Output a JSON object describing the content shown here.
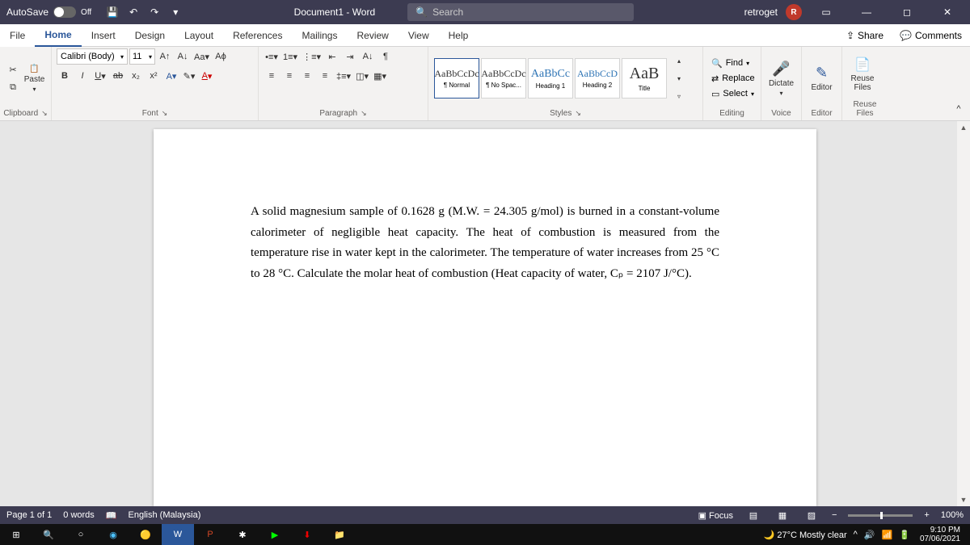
{
  "titlebar": {
    "autosave_label": "AutoSave",
    "autosave_state": "Off",
    "doc_title": "Document1 - Word",
    "search_placeholder": "Search",
    "username": "retroget",
    "user_initial": "R"
  },
  "tabs": {
    "file": "File",
    "items": [
      "Home",
      "Insert",
      "Design",
      "Layout",
      "References",
      "Mailings",
      "Review",
      "View",
      "Help"
    ],
    "active": "Home",
    "share": "Share",
    "comments": "Comments"
  },
  "ribbon": {
    "clipboard": {
      "label": "Clipboard",
      "paste": "Paste"
    },
    "font": {
      "label": "Font",
      "name": "Calibri (Body)",
      "size": "11"
    },
    "paragraph": {
      "label": "Paragraph"
    },
    "styles": {
      "label": "Styles",
      "items": [
        {
          "sample": "AaBbCcDc",
          "name": "¶ Normal"
        },
        {
          "sample": "AaBbCcDc",
          "name": "¶ No Spac..."
        },
        {
          "sample": "AaBbCc",
          "name": "Heading 1"
        },
        {
          "sample": "AaBbCcD",
          "name": "Heading 2"
        },
        {
          "sample": "AaB",
          "name": "Title"
        }
      ]
    },
    "editing": {
      "label": "Editing",
      "find": "Find",
      "replace": "Replace",
      "select": "Select"
    },
    "voice": {
      "label": "Voice",
      "dictate": "Dictate"
    },
    "editor": {
      "label": "Editor",
      "editor": "Editor"
    },
    "reuse": {
      "label": "Reuse Files",
      "reuse": "Reuse Files"
    }
  },
  "document": {
    "paragraph": "A solid magnesium sample of 0.1628 g (M.W. = 24.305 g/mol) is burned in a constant-volume calorimeter of negligible heat capacity. The heat of combustion is measured from the temperature rise in water kept in the calorimeter. The temperature of water increases from 25 °C to 28 °C. Calculate the molar heat of combustion (Heat capacity of water, Cₚ = 2107 J/°C)."
  },
  "statusbar": {
    "page": "Page 1 of 1",
    "words": "0 words",
    "language": "English (Malaysia)",
    "focus": "Focus",
    "zoom": "100%"
  },
  "taskbar": {
    "weather": "27°C  Mostly clear",
    "time": "9:10 PM",
    "date": "07/06/2021"
  }
}
